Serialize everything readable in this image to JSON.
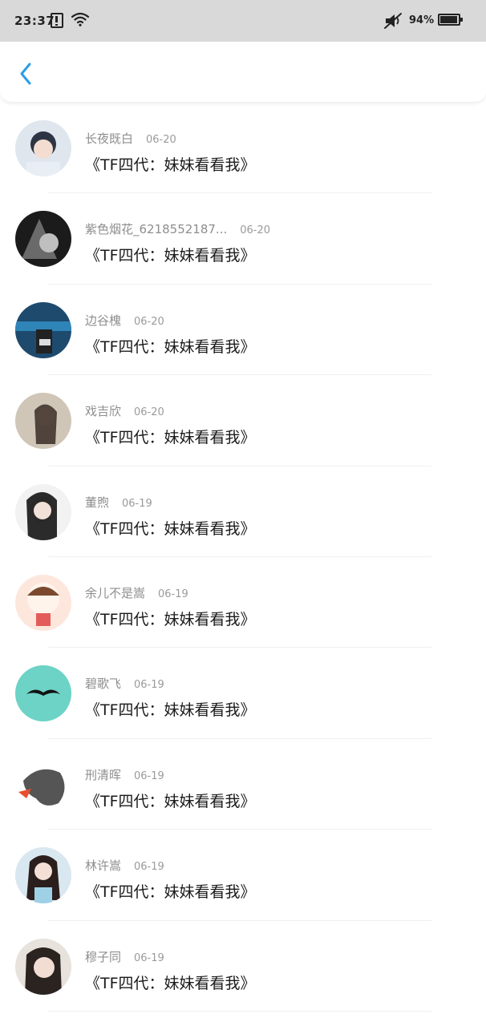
{
  "status_bar": {
    "time": "23:37",
    "battery_percent": "94%",
    "battery_level": 0.94
  },
  "header": {
    "back_icon": "chevron-left-icon",
    "accent_color": "#2b9de8"
  },
  "items": [
    {
      "username": "长夜既白",
      "date": "06-20",
      "message": "《TF四代：妹妹看看我》"
    },
    {
      "username": "紫色烟花_6218552187...",
      "date": "06-20",
      "message": "《TF四代：妹妹看看我》"
    },
    {
      "username": "边谷槐",
      "date": "06-20",
      "message": "《TF四代：妹妹看看我》"
    },
    {
      "username": "戏吉欣",
      "date": "06-20",
      "message": "《TF四代：妹妹看看我》"
    },
    {
      "username": "董煦",
      "date": "06-19",
      "message": "《TF四代：妹妹看看我》"
    },
    {
      "username": "余儿不是嵩",
      "date": "06-19",
      "message": "《TF四代：妹妹看看我》"
    },
    {
      "username": "碧歌飞",
      "date": "06-19",
      "message": "《TF四代：妹妹看看我》"
    },
    {
      "username": "刑清晖",
      "date": "06-19",
      "message": "《TF四代：妹妹看看我》"
    },
    {
      "username": "林许嵩",
      "date": "06-19",
      "message": "《TF四代：妹妹看看我》"
    },
    {
      "username": "穆子同",
      "date": "06-19",
      "message": "《TF四代：妹妹看看我》"
    }
  ]
}
